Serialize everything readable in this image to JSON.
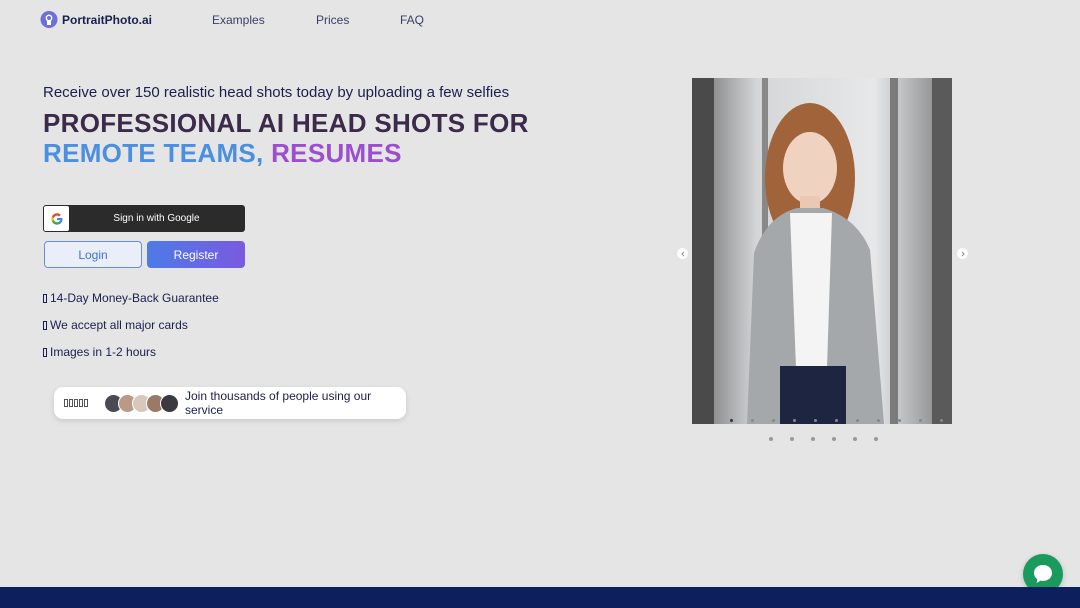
{
  "header": {
    "logo_text": "PortraitPhoto.ai",
    "nav": {
      "examples": "Examples",
      "prices": "Prices",
      "faq": "FAQ"
    }
  },
  "hero": {
    "subhead": "Receive over 150 realistic head shots today by uploading a few selfies",
    "headline_line1": "PROFESSIONAL AI HEAD SHOTS FOR",
    "headline_line2_a": "REMOTE TEAMS,",
    "headline_line2_b": " RESUMES"
  },
  "auth": {
    "google_label": "Sign in with Google",
    "login_label": "Login",
    "register_label": "Register"
  },
  "features": [
    "14-Day Money-Back Guarantee",
    "We accept all major cards",
    "Images in 1-2 hours"
  ],
  "social_proof": {
    "text": "Join thousands of people using our service",
    "star_count": 5
  },
  "carousel": {
    "inner_dot_count": 11,
    "outer_dot_count": 6
  },
  "colors": {
    "accent_blue": "#4a8fe0",
    "accent_purple": "#9b4fd0",
    "chat_green": "#1a9a5c",
    "footer_navy": "#0d1f5c"
  }
}
